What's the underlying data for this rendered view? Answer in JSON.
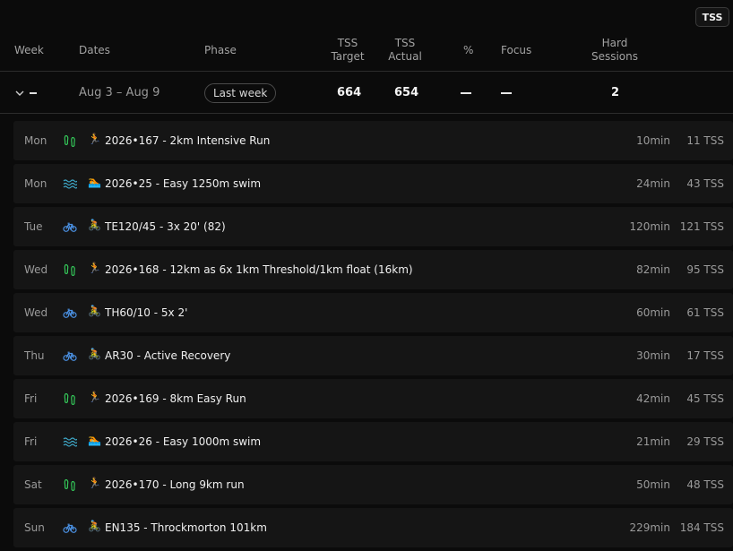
{
  "toggle": {
    "label": "TSS"
  },
  "header": {
    "week": "Week",
    "dates": "Dates",
    "phase": "Phase",
    "tss_target_1": "TSS",
    "tss_target_2": "Target",
    "tss_actual_1": "TSS",
    "tss_actual_2": "Actual",
    "percent": "%",
    "focus": "Focus",
    "hard_1": "Hard",
    "hard_2": "Sessions"
  },
  "week": {
    "dates": "Aug 3 – Aug 9",
    "phase": "Last week",
    "tss_target": "664",
    "tss_actual": "654",
    "hard_sessions": "2"
  },
  "colors": {
    "run": "#34c759",
    "swim": "#3fa9c9",
    "bike": "#4a8fe0"
  },
  "workouts": [
    {
      "day": "Mon",
      "sport": "run-icon",
      "emoji": "🏃",
      "title": "2026•167 - 2km Intensive Run",
      "duration": "10min",
      "tss": "11 TSS"
    },
    {
      "day": "Mon",
      "sport": "swim-icon",
      "emoji": "🏊",
      "title": "2026•25 - Easy 1250m swim",
      "duration": "24min",
      "tss": "43 TSS"
    },
    {
      "day": "Tue",
      "sport": "bike-icon",
      "emoji": "🚴",
      "title": "TE120/45 - 3x 20' (82)",
      "duration": "120min",
      "tss": "121 TSS"
    },
    {
      "day": "Wed",
      "sport": "run-icon",
      "emoji": "🏃",
      "title": "2026•168 - 12km as 6x 1km Threshold/1km float (16km)",
      "duration": "82min",
      "tss": "95 TSS"
    },
    {
      "day": "Wed",
      "sport": "bike-icon",
      "emoji": "🚴",
      "title": "TH60/10 - 5x 2'",
      "duration": "60min",
      "tss": "61 TSS"
    },
    {
      "day": "Thu",
      "sport": "bike-icon",
      "emoji": "🚴",
      "title": "AR30 - Active Recovery",
      "duration": "30min",
      "tss": "17 TSS"
    },
    {
      "day": "Fri",
      "sport": "run-icon",
      "emoji": "🏃",
      "title": "2026•169 - 8km Easy Run",
      "duration": "42min",
      "tss": "45 TSS"
    },
    {
      "day": "Fri",
      "sport": "swim-icon",
      "emoji": "🏊",
      "title": "2026•26 - Easy 1000m swim",
      "duration": "21min",
      "tss": "29 TSS"
    },
    {
      "day": "Sat",
      "sport": "run-icon",
      "emoji": "🏃",
      "title": "2026•170 - Long 9km run",
      "duration": "50min",
      "tss": "48 TSS"
    },
    {
      "day": "Sun",
      "sport": "bike-icon",
      "emoji": "🚴",
      "title": "EN135 - Throckmorton 101km",
      "duration": "229min",
      "tss": "184 TSS"
    }
  ]
}
